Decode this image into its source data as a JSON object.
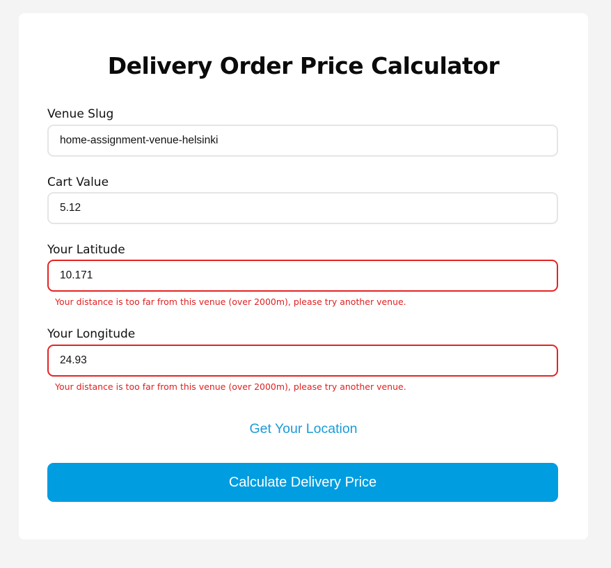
{
  "page_title": "Delivery Order Price Calculator",
  "fields": {
    "venue_slug": {
      "label": "Venue Slug",
      "value": "home-assignment-venue-helsinki"
    },
    "cart_value": {
      "label": "Cart Value",
      "value": "5.12"
    },
    "latitude": {
      "label": "Your Latitude",
      "value": "10.171",
      "error": "Your distance is too far from this venue (over 2000m), please try another venue."
    },
    "longitude": {
      "label": "Your Longitude",
      "value": "24.93",
      "error": "Your distance is too far from this venue (over 2000m), please try another venue."
    }
  },
  "actions": {
    "get_location_label": "Get Your Location",
    "calculate_label": "Calculate Delivery Price"
  },
  "colors": {
    "accent": "#009de0",
    "link": "#1a9bd7",
    "error": "#e01f1f",
    "error_border": "#e52222",
    "page_background": "#f4f4f4"
  }
}
